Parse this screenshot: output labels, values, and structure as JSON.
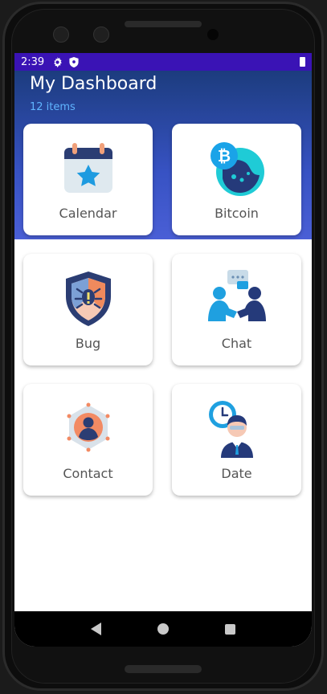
{
  "statusbar": {
    "time": "2:39",
    "icons": [
      "gear-icon",
      "shield-icon",
      "battery-icon"
    ]
  },
  "header": {
    "title": "My Dashboard",
    "subtitle": "12 items"
  },
  "cards": [
    {
      "label": "Calendar",
      "icon": "calendar-icon"
    },
    {
      "label": "Bitcoin",
      "icon": "bitcoin-icon"
    },
    {
      "label": "Bug",
      "icon": "bug-shield-icon"
    },
    {
      "label": "Chat",
      "icon": "chat-icon"
    },
    {
      "label": "Contact",
      "icon": "contact-icon"
    },
    {
      "label": "Date",
      "icon": "date-icon"
    }
  ],
  "navbar": {
    "icons": [
      "back-icon",
      "home-icon",
      "recents-icon"
    ]
  },
  "colors": {
    "status": "#3a13b5",
    "header_top": "#1c3c7e",
    "header_bottom": "#4a5fd6",
    "subtitle": "#60b5ff"
  }
}
